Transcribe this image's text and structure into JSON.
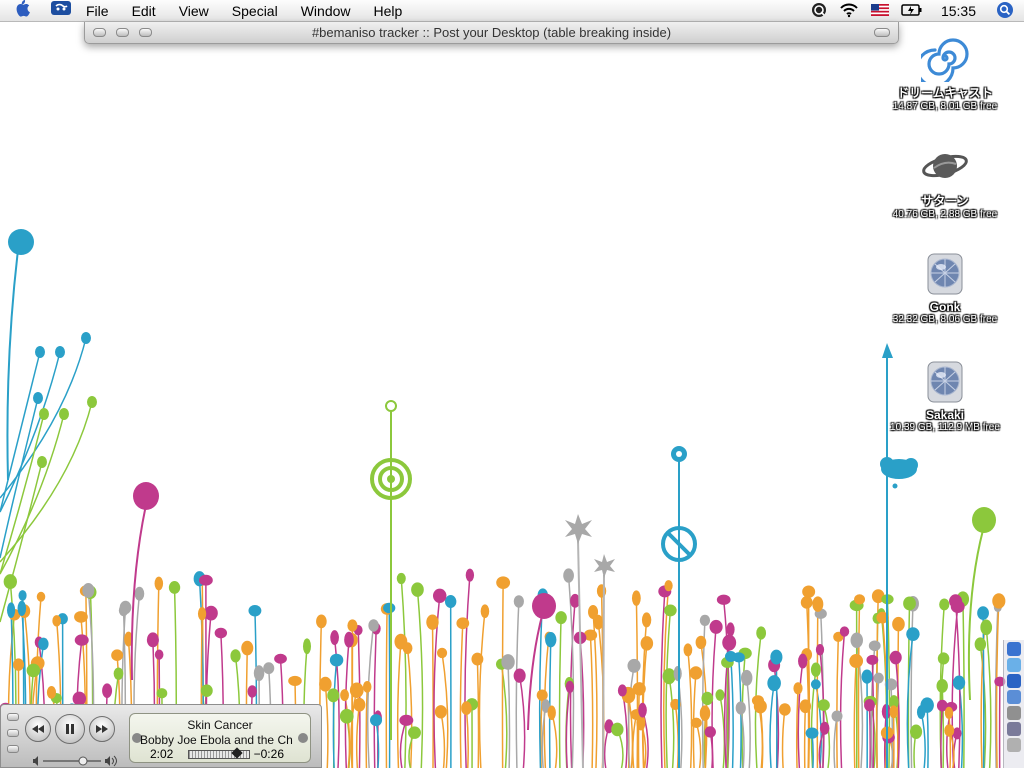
{
  "menubar": {
    "apple_icon": "apple-icon",
    "finder_icon": "finder-icon",
    "items": [
      "File",
      "Edit",
      "View",
      "Special",
      "Window",
      "Help"
    ],
    "status_icons": [
      "quicksilver-icon",
      "wifi-icon",
      "us-flag-icon",
      "battery-icon"
    ],
    "clock": "15:35",
    "spotlight_icon": "spotlight-icon"
  },
  "window": {
    "title": "#bemaniso tracker :: Post your Desktop (table breaking inside)"
  },
  "desktop": {
    "disks": [
      {
        "name": "ドリームキャスト",
        "info": "14.87 GB, 8.01 GB free",
        "icon": "dreamcast-swirl-icon"
      },
      {
        "name": "サターン",
        "info": "40.76 GB, 2.88 GB free",
        "icon": "saturn-icon"
      },
      {
        "name": "Gonk",
        "info": "32.32 GB, 8.06 GB free",
        "icon": "hard-disk-icon"
      },
      {
        "name": "Sakaki",
        "info": "10.39 GB, 112.9 MB free",
        "icon": "hard-disk-icon"
      }
    ],
    "accent_colors": {
      "teal": "#2aa0c8",
      "magenta": "#c03a8c",
      "orange": "#f0a030",
      "green": "#8cc83c",
      "grey": "#a8a8a8"
    }
  },
  "itunes": {
    "song": "Skin Cancer",
    "artist": "Bobby Joe Ebola and the Ch",
    "elapsed": "2:02",
    "remaining": "−0:26",
    "progress": 0.8
  }
}
